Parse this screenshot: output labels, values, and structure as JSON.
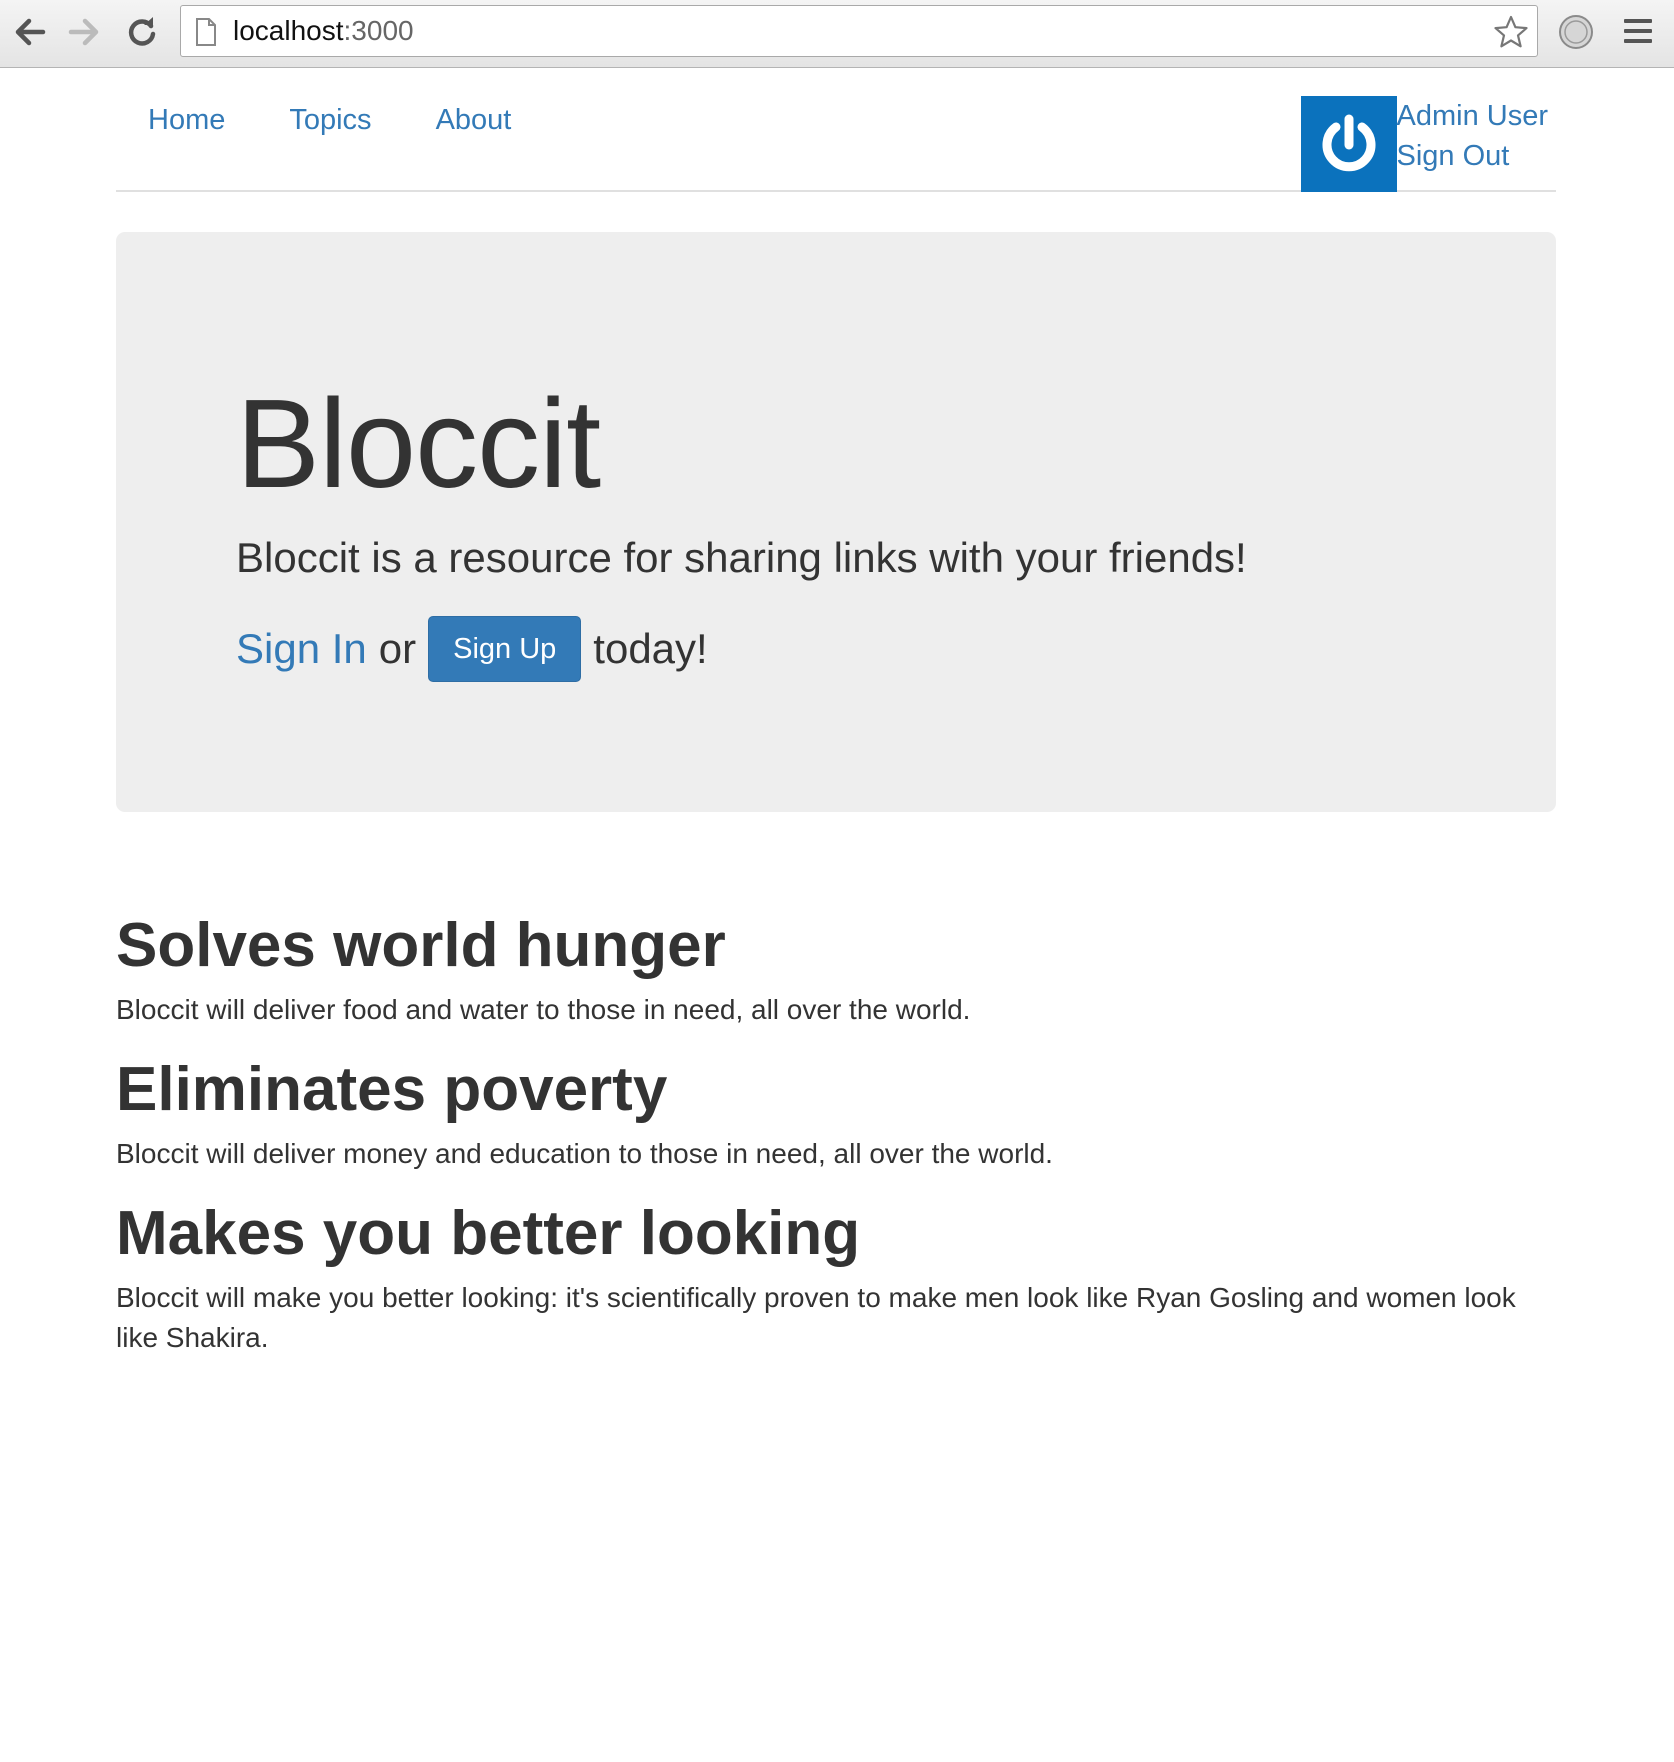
{
  "browser": {
    "url_host": "localhost",
    "url_port": ":3000",
    "icons": {
      "back": "back-arrow-icon",
      "forward": "forward-arrow-icon",
      "reload": "reload-icon",
      "page": "page-icon",
      "bookmark": "star-icon",
      "extension": "extension-icon",
      "menu": "hamburger-menu-icon"
    }
  },
  "navbar": {
    "links": [
      "Home",
      "Topics",
      "About"
    ],
    "user_name": "Admin User",
    "sign_out": "Sign Out",
    "avatar_color": "#0b72bd"
  },
  "hero": {
    "title": "Bloccit",
    "lead": "Bloccit is a resource for sharing links with your friends!",
    "sign_in": "Sign In",
    "or": "or",
    "sign_up": "Sign Up",
    "today": "today!"
  },
  "features": [
    {
      "heading": "Solves world hunger",
      "text": "Bloccit will deliver food and water to those in need, all over the world."
    },
    {
      "heading": "Eliminates poverty",
      "text": "Bloccit will deliver money and education to those in need, all over the world."
    },
    {
      "heading": "Makes you better looking",
      "text": "Bloccit will make you better looking: it's scientifically proven to make men look like Ryan Gosling and women look like Shakira."
    }
  ],
  "colors": {
    "link": "#337ab7",
    "jumbotron_bg": "#eeeeee",
    "text": "#333333"
  }
}
